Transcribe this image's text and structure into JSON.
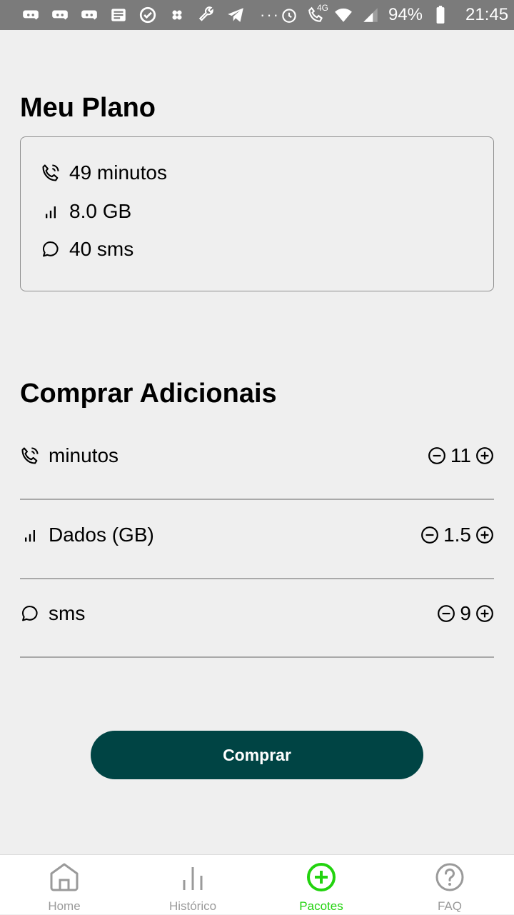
{
  "status_bar": {
    "network": "4G",
    "battery": "94%",
    "time": "21:45"
  },
  "plan": {
    "title": "Meu Plano",
    "items": [
      {
        "icon": "phone-icon",
        "text": "49 minutos"
      },
      {
        "icon": "signal-icon",
        "text": "8.0 GB"
      },
      {
        "icon": "chat-bubble-icon",
        "text": "40 sms"
      }
    ]
  },
  "addons": {
    "title": "Comprar Adicionais",
    "items": [
      {
        "icon": "phone-icon",
        "label": "minutos",
        "value": "11"
      },
      {
        "icon": "signal-icon",
        "label": "Dados (GB)",
        "value": "1.5"
      },
      {
        "icon": "chat-bubble-icon",
        "label": "sms",
        "value": "9"
      }
    ]
  },
  "buy_button": {
    "label": "Comprar"
  },
  "nav": {
    "items": [
      {
        "icon": "home-icon",
        "label": "Home"
      },
      {
        "icon": "bar-chart-icon",
        "label": "Histórico"
      },
      {
        "icon": "plus-circle-icon",
        "label": "Pacotes"
      },
      {
        "icon": "question-circle-icon",
        "label": "FAQ"
      }
    ],
    "active_color": "#22d30e",
    "inactive_color": "#9a9a9a"
  },
  "colors": {
    "primary_button": "#004444",
    "background": "#efefef",
    "status_bar": "#7b7b7b"
  }
}
